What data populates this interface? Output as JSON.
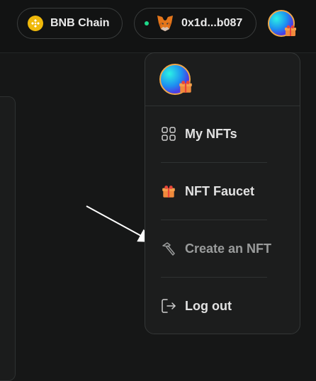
{
  "header": {
    "network_label": "BNB Chain",
    "network_icon": "bnb-icon",
    "wallet_address": "0x1d...b087",
    "wallet_icon": "metamask-fox-icon",
    "status_color": "#1ed98a"
  },
  "menu": {
    "items": [
      {
        "label": "My NFTs",
        "icon": "grid-icon"
      },
      {
        "label": "NFT Faucet",
        "icon": "gift-box-icon"
      },
      {
        "label": "Create an NFT",
        "icon": "hammer-icon"
      },
      {
        "label": "Log out",
        "icon": "logout-icon"
      }
    ]
  },
  "colors": {
    "accent_gold": "#f0b90b",
    "background": "#161717",
    "panel": "#1c1d1d"
  }
}
